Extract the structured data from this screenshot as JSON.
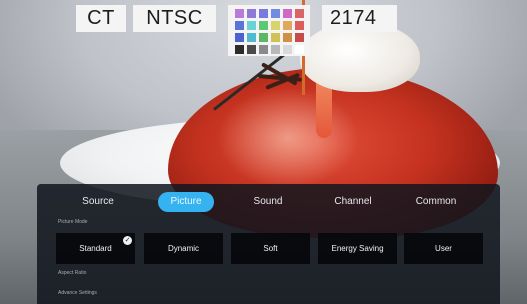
{
  "osd": {
    "color_temp_label": "CT",
    "standard_label": "NTSC",
    "number_readout": "2174",
    "swatch_colors": [
      "#b97bd8",
      "#8e7ad6",
      "#7a79dd",
      "#6f8de0",
      "#cf6bc3",
      "#d86666",
      "#5a73db",
      "#6bd1d8",
      "#5cc776",
      "#d8d469",
      "#e0a85a",
      "#dd5c5c",
      "#4b63d1",
      "#4fbad0",
      "#59b766",
      "#d1c256",
      "#d18f44",
      "#c44c4c",
      "#2c2c2c",
      "#4a4a4a",
      "#8a8a8a",
      "#b8b8b8",
      "#d9d9d9",
      "#ffffff"
    ]
  },
  "menu": {
    "tabs": [
      {
        "label": "Source"
      },
      {
        "label": "Picture"
      },
      {
        "label": "Sound"
      },
      {
        "label": "Channel"
      },
      {
        "label": "Common"
      }
    ],
    "active_tab": "Picture",
    "accent_color": "#35b2f0",
    "picture_mode_label": "Picture Mode",
    "modes": [
      {
        "label": "Standard",
        "selected": true
      },
      {
        "label": "Dynamic",
        "selected": false
      },
      {
        "label": "Soft",
        "selected": false
      },
      {
        "label": "Energy Saving",
        "selected": false
      },
      {
        "label": "User",
        "selected": false
      }
    ],
    "aspect_ratio_label": "Aspect Ratio",
    "advance_settings_label": "Advance Settings",
    "check_icon": "check-circle-icon"
  }
}
